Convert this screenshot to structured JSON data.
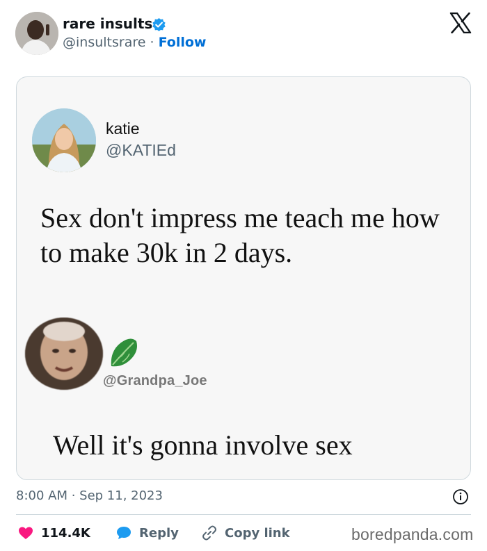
{
  "header": {
    "display_name": "rare insults",
    "handle": "@insultsrare",
    "separator": " · ",
    "follow_label": "Follow",
    "verified_color": "#1d9bf0"
  },
  "embedded_image": {
    "first_post": {
      "name": "katie",
      "handle": "@KATIEd",
      "text": "Sex don't impress me teach me how to make 30k in 2 days."
    },
    "reply_post": {
      "handle": "@Grandpa_Joe",
      "emoji_icon": "lettuce-icon",
      "text": "Well it's gonna involve sex"
    }
  },
  "footer": {
    "timestamp": "8:00 AM · Sep 11, 2023",
    "likes": "114.4K",
    "reply_label": "Reply",
    "copy_link_label": "Copy link",
    "like_color": "#f91880",
    "reply_color": "#1d9bf0"
  },
  "watermark": "boredpanda.com"
}
